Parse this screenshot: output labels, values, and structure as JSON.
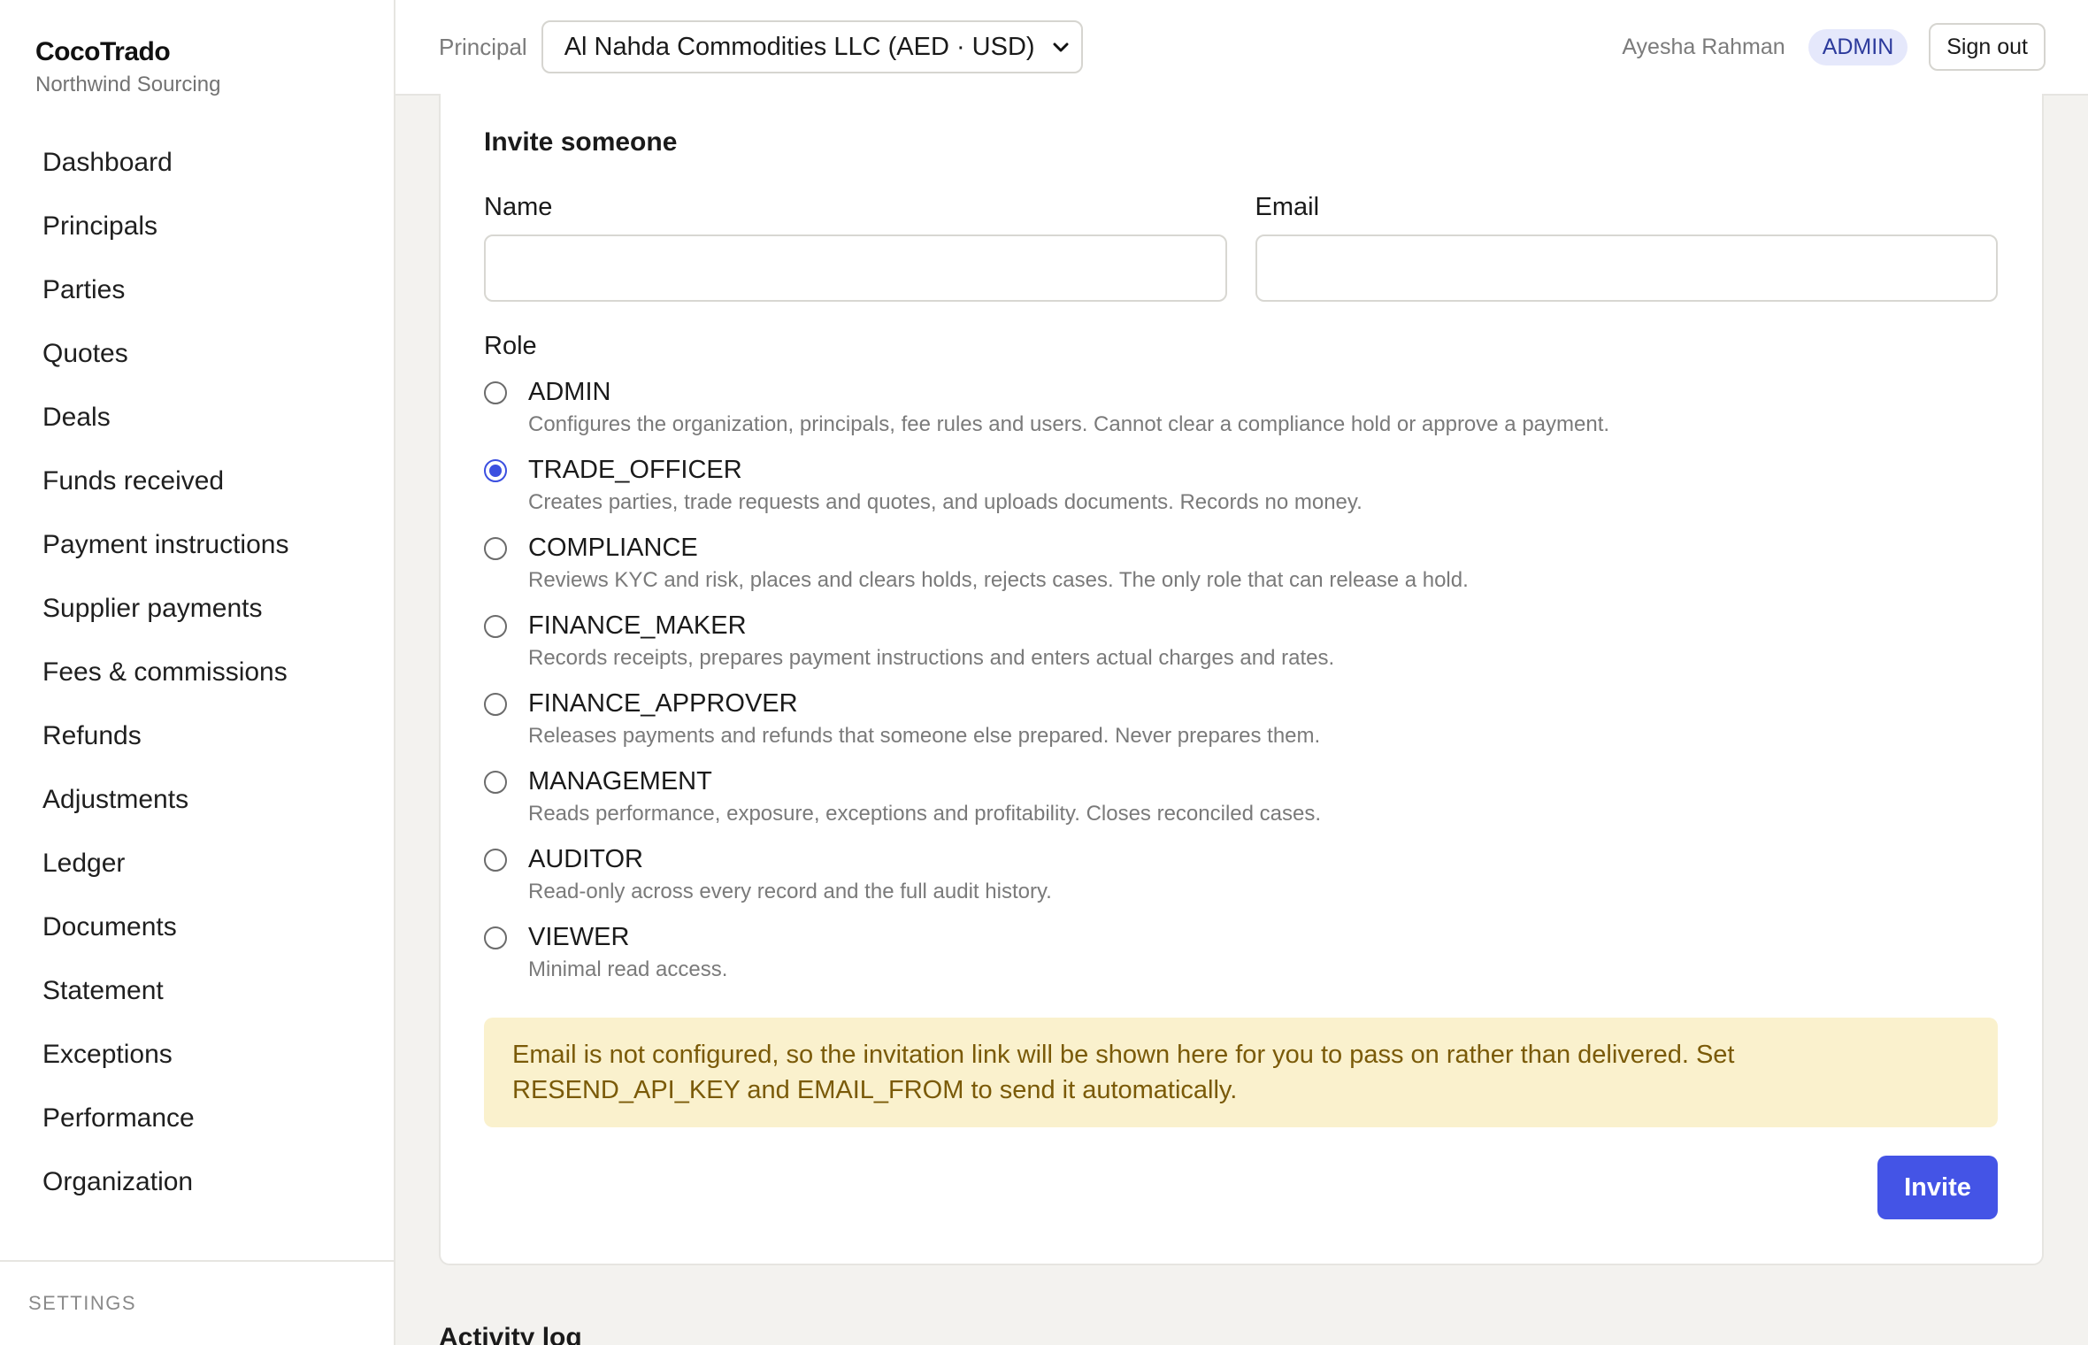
{
  "brand": {
    "name": "CocoTrado",
    "subtitle": "Northwind Sourcing"
  },
  "nav": [
    "Dashboard",
    "Principals",
    "Parties",
    "Quotes",
    "Deals",
    "Funds received",
    "Payment instructions",
    "Supplier payments",
    "Fees & commissions",
    "Refunds",
    "Adjustments",
    "Ledger",
    "Documents",
    "Statement",
    "Exceptions",
    "Performance",
    "Organization"
  ],
  "sidebar_footer": {
    "settings_label": "SETTINGS"
  },
  "topbar": {
    "principal_label": "Principal",
    "principal_value": "Al Nahda Commodities LLC (AED · USD)",
    "user_name": "Ayesha Rahman",
    "role_badge": "ADMIN",
    "signout_label": "Sign out"
  },
  "invite": {
    "title": "Invite someone",
    "name_label": "Name",
    "name_value": "",
    "email_label": "Email",
    "email_value": "",
    "role_label": "Role",
    "selected_role": "TRADE_OFFICER",
    "roles": [
      {
        "name": "ADMIN",
        "description": "Configures the organization, principals, fee rules and users. Cannot clear a compliance hold or approve a payment."
      },
      {
        "name": "TRADE_OFFICER",
        "description": "Creates parties, trade requests and quotes, and uploads documents. Records no money."
      },
      {
        "name": "COMPLIANCE",
        "description": "Reviews KYC and risk, places and clears holds, rejects cases. The only role that can release a hold."
      },
      {
        "name": "FINANCE_MAKER",
        "description": "Records receipts, prepares payment instructions and enters actual charges and rates."
      },
      {
        "name": "FINANCE_APPROVER",
        "description": "Releases payments and refunds that someone else prepared. Never prepares them."
      },
      {
        "name": "MANAGEMENT",
        "description": "Reads performance, exposure, exceptions and profitability. Closes reconciled cases."
      },
      {
        "name": "AUDITOR",
        "description": "Read-only across every record and the full audit history."
      },
      {
        "name": "VIEWER",
        "description": "Minimal read access."
      }
    ],
    "notice": "Email is not configured, so the invitation link will be shown here for you to pass on rather than delivered. Set RESEND_API_KEY and EMAIL_FROM to send it automatically.",
    "invite_label": "Invite"
  },
  "activity": {
    "title": "Activity log"
  },
  "colors": {
    "accent": "#4454e6",
    "notice_bg": "#faf1cd",
    "notice_text": "#7a5a08",
    "badge_bg": "#e5e8fb"
  }
}
